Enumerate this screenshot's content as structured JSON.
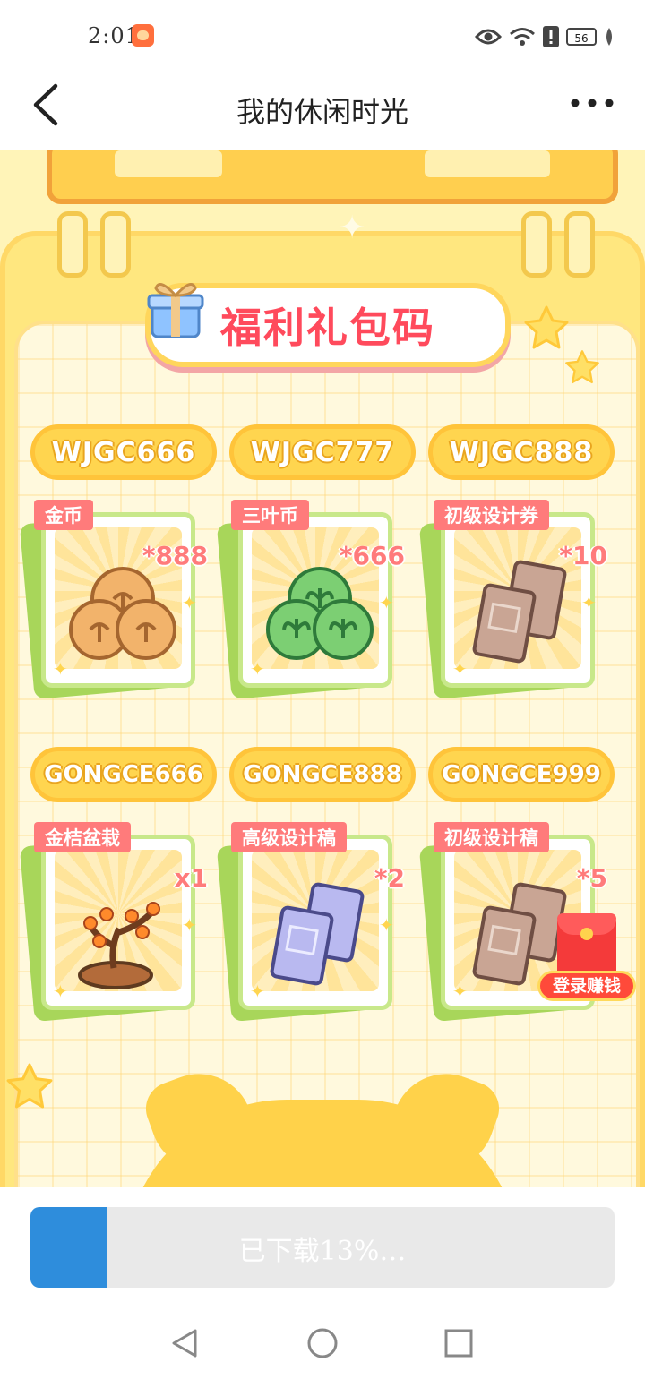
{
  "status_bar": {
    "time": "2:01",
    "battery": "56"
  },
  "nav": {
    "title": "我的休闲时光"
  },
  "promo": {
    "header": "福利礼包码",
    "codes": [
      {
        "code": "WJGC666",
        "reward_name": "金币",
        "reward_qty": "*888",
        "item_icon": "gold-coins-icon"
      },
      {
        "code": "WJGC777",
        "reward_name": "三叶币",
        "reward_qty": "*666",
        "item_icon": "clover-coins-icon"
      },
      {
        "code": "WJGC888",
        "reward_name": "初级设计券",
        "reward_qty": "*10",
        "item_icon": "scroll-icon"
      },
      {
        "code": "GONGCE666",
        "reward_name": "金桔盆栽",
        "reward_qty": "x1",
        "item_icon": "kumquat-bonsai-icon"
      },
      {
        "code": "GONGCE888",
        "reward_name": "高级设计稿",
        "reward_qty": "*2",
        "item_icon": "blueprint-icon"
      },
      {
        "code": "GONGCE999",
        "reward_name": "初级设计稿",
        "reward_qty": "*5",
        "item_icon": "scroll-icon"
      }
    ],
    "floating_button": "登录赚钱"
  },
  "download": {
    "label": "已下载13%…",
    "progress_percent": 13
  },
  "colors": {
    "accent": "#2e8ddc",
    "pill": "#ffd54f",
    "label": "#ff7b7b",
    "header_text": "#ff4a5c"
  }
}
